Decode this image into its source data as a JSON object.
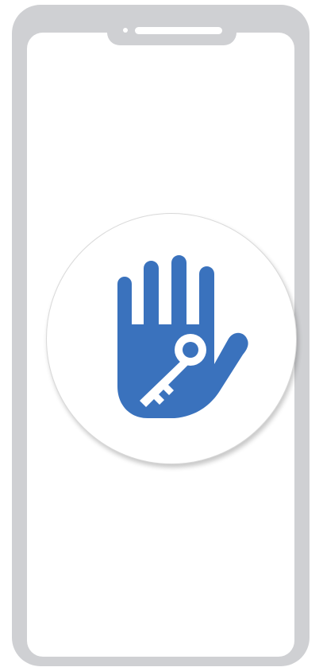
{
  "device": {
    "type": "smartphone",
    "frame_color": "#cfd0d3",
    "screen_color": "#ffffff"
  },
  "badge": {
    "icon": "hand-key-icon",
    "icon_color": "#3a72bd",
    "background": "#ffffff"
  }
}
